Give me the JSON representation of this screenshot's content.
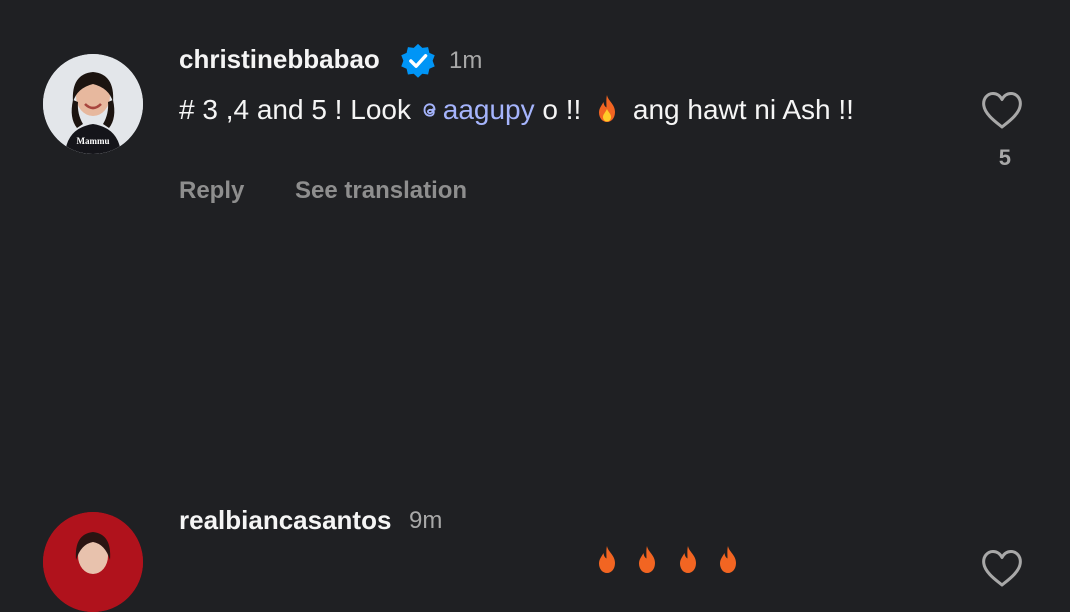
{
  "comments": [
    {
      "username": "christinebbabao",
      "verified": true,
      "time": "1m",
      "text_prefix": "# 3 ,4 and 5 ! Look ",
      "mention": "aagupy",
      "text_suffix": "  o !! ",
      "text_after_emoji": " ang hawt ni Ash !!",
      "emoji": "fire",
      "avatar_label": "Mammu",
      "like_count": "5",
      "actions": {
        "reply": "Reply",
        "translate": "See translation"
      }
    },
    {
      "username": "realbiancasantos",
      "time": "9m",
      "emoji": "fire"
    }
  ],
  "colors": {
    "background": "#1f2023",
    "mention": "#a5b4fc",
    "verified": "#0095f6",
    "secondary_text": "#8e8e8e"
  }
}
